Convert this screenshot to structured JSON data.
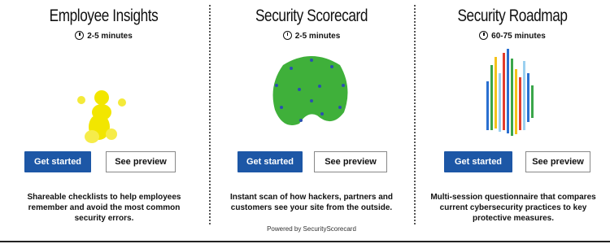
{
  "cards": [
    {
      "title": "Employee Insights",
      "duration": "2-5 minutes",
      "primary_label": "Get started",
      "secondary_label": "See preview",
      "description": "Shareable checklists to help employees remember and avoid the most common security errors.",
      "colors": {
        "art": "#f2e600"
      }
    },
    {
      "title": "Security Scorecard",
      "duration": "2-5 minutes",
      "primary_label": "Get started",
      "secondary_label": "See preview",
      "description": "Instant scan of how hackers, partners and customers see your site from the outside.",
      "byline": "Powered by SecurityScorecard",
      "colors": {
        "art": "#3fb03a",
        "dots": "#2a4fb0"
      }
    },
    {
      "title": "Security Roadmap",
      "duration": "60-75 minutes",
      "primary_label": "Get started",
      "secondary_label": "See preview",
      "description": "Multi-session questionnaire that compares current cybersecurity practices to key protective measures.",
      "colors": {
        "bars": [
          "#e23c2c",
          "#f4c21a",
          "#3aa64a",
          "#2a6fd0",
          "#9bd0f0"
        ]
      }
    }
  ],
  "colors": {
    "primary_button": "#1d57a6"
  }
}
